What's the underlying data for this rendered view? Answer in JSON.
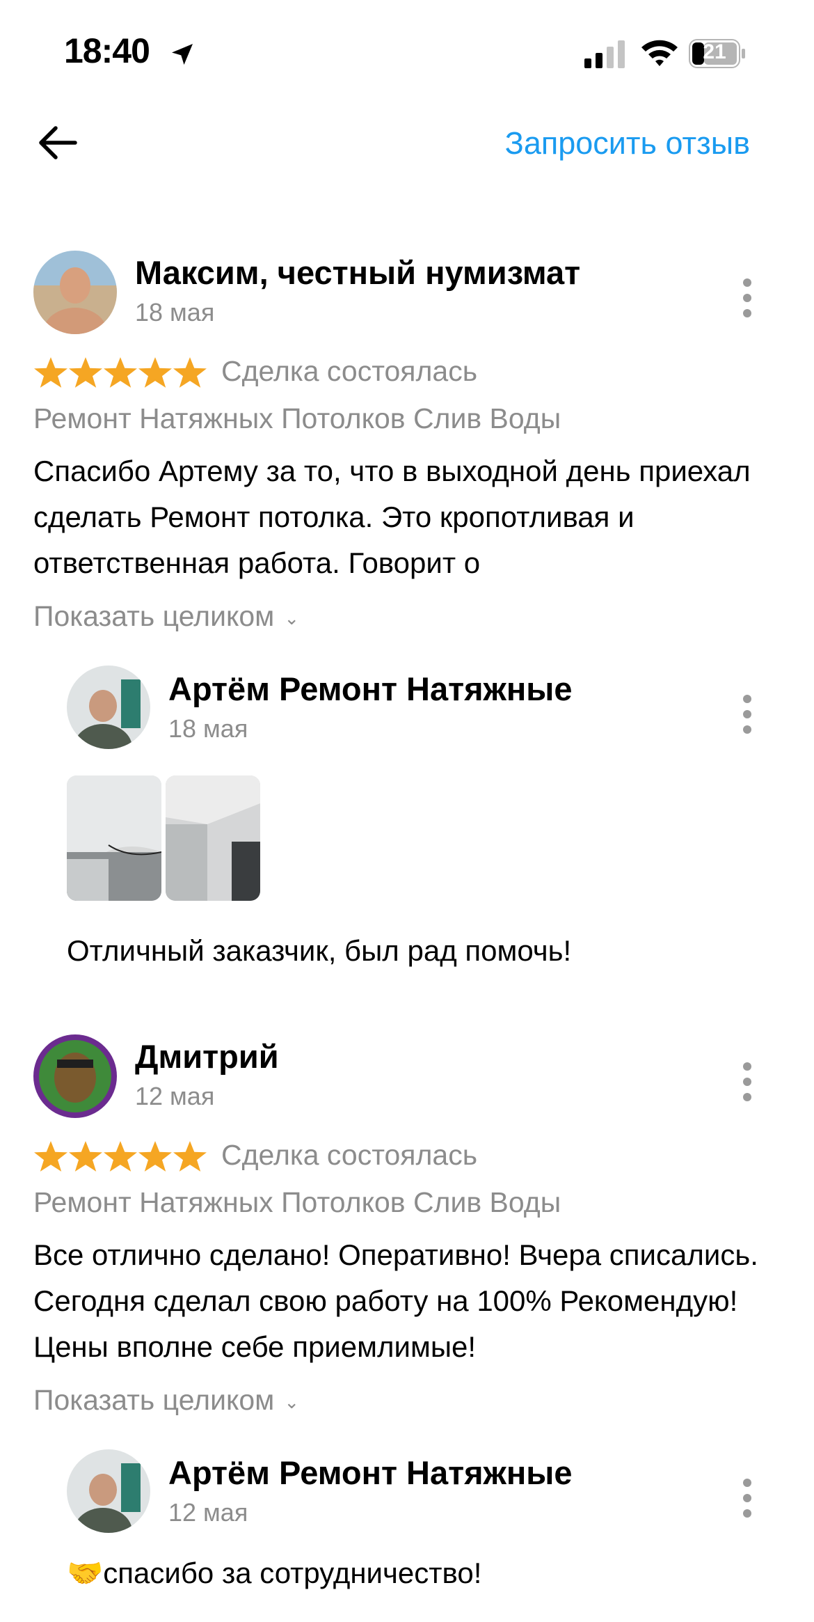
{
  "status_bar": {
    "time": "18:40",
    "battery": "21"
  },
  "nav": {
    "request_review": "Запросить отзыв"
  },
  "show_full_label": "Показать целиком",
  "reviews": [
    {
      "author": "Максим, честный нумизмат",
      "date": "18 мая",
      "rating": 5,
      "deal_status": "Сделка состоялась",
      "service": "Ремонт Натяжных Потолков Слив Воды",
      "text": "Спасибо Артему за то, что в выходной день приехал сделать Ремонт потолка. Это кропотливая и ответственная работа. Говорит о",
      "reply": {
        "author": "Артём Ремонт Натяжные",
        "date": "18 мая",
        "text": "Отличный заказчик, был рад помочь!"
      }
    },
    {
      "author": "Дмитрий",
      "date": "12 мая",
      "rating": 5,
      "deal_status": "Сделка состоялась",
      "service": "Ремонт Натяжных Потолков Слив Воды",
      "text": "Все отлично сделано! Оперативно! Вчера списались. Сегодня сделал свою работу на 100% Рекомендую! Цены вполне себе приемлимые!",
      "reply": {
        "author": "Артём Ремонт Натяжные",
        "date": "12 мая",
        "text": "🤝спасибо за сотрудничество!"
      }
    }
  ],
  "colors": {
    "accent": "#1a9bf0",
    "star": "#f5a623",
    "muted": "#8c8c8c"
  }
}
